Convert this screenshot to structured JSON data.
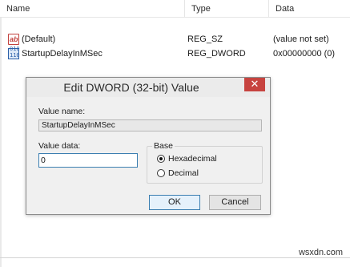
{
  "columns": {
    "name": "Name",
    "type": "Type",
    "data": "Data"
  },
  "values": [
    {
      "icon": "string-value-icon",
      "icon_text": "ab",
      "name": "(Default)",
      "type": "REG_SZ",
      "data": "(value not set)"
    },
    {
      "icon": "dword-value-icon",
      "icon_text": "010\n110",
      "name": "StartupDelayInMSec",
      "type": "REG_DWORD",
      "data": "0x00000000 (0)"
    }
  ],
  "dialog": {
    "title": "Edit DWORD (32-bit) Value",
    "close_glyph": "✕",
    "value_name_label": "Value name:",
    "value_name": "StartupDelayInMSec",
    "value_data_label": "Value data:",
    "value_data": "0",
    "base_label": "Base",
    "hex_label": "Hexadecimal",
    "dec_label": "Decimal",
    "selected_base": "Hexadecimal",
    "ok_label": "OK",
    "cancel_label": "Cancel"
  },
  "watermark": "wsxdn.com"
}
